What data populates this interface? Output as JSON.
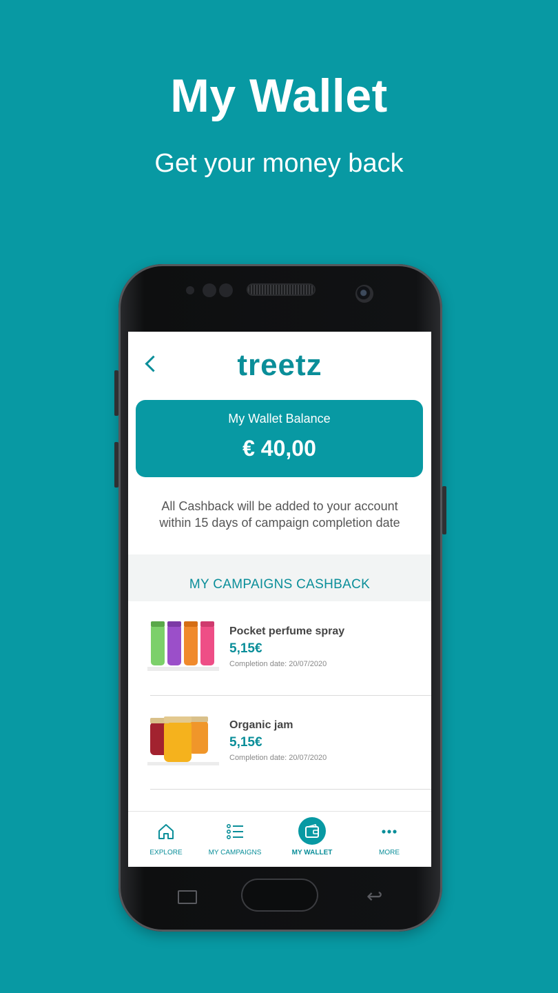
{
  "promo": {
    "title": "My Wallet",
    "subtitle": "Get your money back"
  },
  "app": {
    "logo_text": "treetz",
    "back_icon": "chevron-left-icon"
  },
  "wallet": {
    "balance_label": "My Wallet Balance",
    "balance_value": "€ 40,00",
    "note_line1": "All Cashback will be added to your account",
    "note_line2": "within 15 days of campaign completion date"
  },
  "campaigns": {
    "section_title": "MY CAMPAIGNS CASHBACK",
    "items": [
      {
        "name": "Pocket perfume spray",
        "amount": "5,15€",
        "date": "Completion date: 20/07/2020"
      },
      {
        "name": "Organic jam",
        "amount": "5,15€",
        "date": "Completion date: 20/07/2020"
      }
    ]
  },
  "bottom_nav": {
    "items": [
      {
        "label": "EXPLORE",
        "icon": "home-icon"
      },
      {
        "label": "MY CAMPAIGNS",
        "icon": "list-icon"
      },
      {
        "label": "MY WALLET",
        "icon": "wallet-icon",
        "active": true
      },
      {
        "label": "MORE",
        "icon": "more-dots-icon"
      }
    ]
  },
  "colors": {
    "brand": "#0899a3",
    "accent_text": "#0a8e99"
  }
}
